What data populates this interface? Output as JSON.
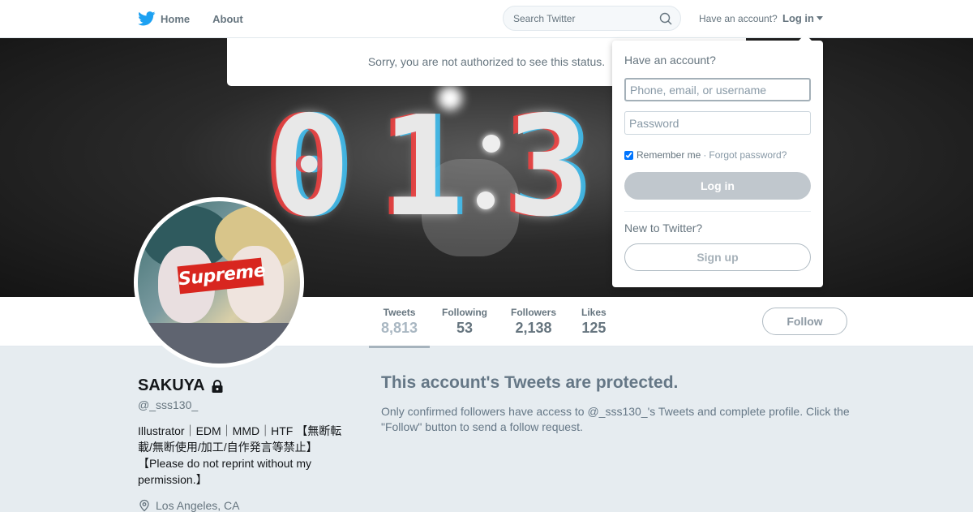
{
  "nav": {
    "home_label": "Home",
    "about_label": "About",
    "search_placeholder": "Search Twitter",
    "have_account": "Have an account?",
    "login_label": "Log in"
  },
  "alert": {
    "message": "Sorry, you are not authorized to see this status."
  },
  "banner": {
    "digits": [
      "0",
      "1",
      "3"
    ]
  },
  "login_dropdown": {
    "title": "Have an account?",
    "username_placeholder": "Phone, email, or username",
    "password_placeholder": "Password",
    "remember_me": "Remember me",
    "remember_checked": true,
    "separator": "·",
    "forgot_password": "Forgot password?",
    "login_button": "Log in",
    "new_to_twitter": "New to Twitter?",
    "signup_button": "Sign up"
  },
  "stats": [
    {
      "label": "Tweets",
      "value": "8,813",
      "active": true
    },
    {
      "label": "Following",
      "value": "53",
      "active": false
    },
    {
      "label": "Followers",
      "value": "2,138",
      "active": false
    },
    {
      "label": "Likes",
      "value": "125",
      "active": false
    }
  ],
  "follow_button": "Follow",
  "avatar": {
    "logo_text": "Supreme"
  },
  "profile": {
    "name": "SAKUYA",
    "handle": "@_sss130_",
    "bio": "Illustrator｜EDM｜MMD｜HTF 【無断転載/無断使用/加工/自作発言等禁止】【Please do not reprint without my permission.】",
    "location": "Los Angeles, CA"
  },
  "protected": {
    "title": "This account's Tweets are protected.",
    "text": "Only confirmed followers have access to @_sss130_'s Tweets and complete profile. Click the \"Follow\" button to send a follow request."
  },
  "colors": {
    "twitter_blue": "#1da1f2",
    "page_background": "#e6ecf0",
    "muted_text": "#657786",
    "disabled_button": "#c0c7cd"
  }
}
